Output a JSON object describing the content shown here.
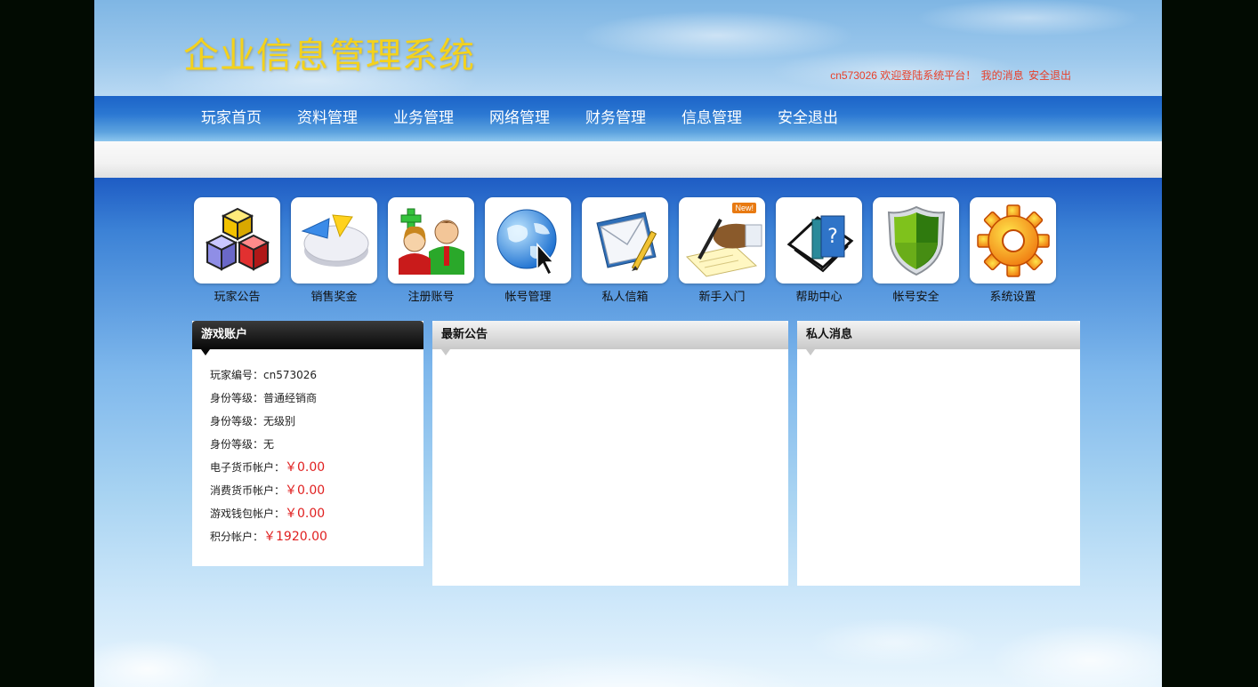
{
  "header": {
    "title": "企业信息管理系统",
    "welcome": "cn573026 欢迎登陆系统平台！",
    "my_messages": "我的消息",
    "logout": "安全退出"
  },
  "nav": {
    "items": [
      {
        "label": "玩家首页"
      },
      {
        "label": "资料管理"
      },
      {
        "label": "业务管理"
      },
      {
        "label": "网络管理"
      },
      {
        "label": "财务管理"
      },
      {
        "label": "信息管理"
      },
      {
        "label": "安全退出"
      }
    ]
  },
  "shortcuts": [
    {
      "label": "玩家公告",
      "icon": "cubes-icon"
    },
    {
      "label": "销售奖金",
      "icon": "pie-chart-icon"
    },
    {
      "label": "注册账号",
      "icon": "add-user-icon"
    },
    {
      "label": "帐号管理",
      "icon": "globe-cursor-icon"
    },
    {
      "label": "私人信箱",
      "icon": "envelope-icon"
    },
    {
      "label": "新手入门",
      "icon": "writing-hand-icon",
      "badge": "New!"
    },
    {
      "label": "帮助中心",
      "icon": "help-book-icon"
    },
    {
      "label": "帐号安全",
      "icon": "shield-icon"
    },
    {
      "label": "系统设置",
      "icon": "gear-icon"
    }
  ],
  "account_panel": {
    "title": "游戏账户",
    "rows": [
      {
        "label": "玩家编号：",
        "value": "cn573026"
      },
      {
        "label": "身份等级：",
        "value": "普通经销商"
      },
      {
        "label": "身份等级：",
        "value": "无级别"
      },
      {
        "label": "身份等级：",
        "value": "无"
      },
      {
        "label": "电子货币帐户：",
        "value": "￥0.00"
      },
      {
        "label": "消费货币帐户：",
        "value": "￥0.00"
      },
      {
        "label": "游戏钱包帐户：",
        "value": "￥0.00"
      },
      {
        "label": "积分帐户：",
        "value": "￥1920.00"
      }
    ]
  },
  "news_panel": {
    "title": "最新公告"
  },
  "messages_panel": {
    "title": "私人消息"
  },
  "colors": {
    "title_yellow": "#f4d21c",
    "userbar_red": "#e8402a",
    "money_red": "#e02020",
    "nav_blue": "#1c63c8"
  }
}
